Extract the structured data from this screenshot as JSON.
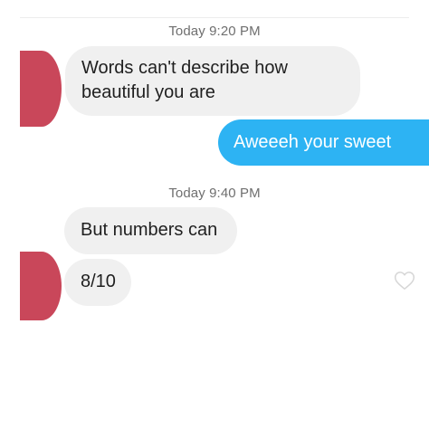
{
  "conversation": {
    "timestamps": [
      "Today 9:20 PM",
      "Today 9:40 PM"
    ],
    "messages": [
      {
        "text": "Words can't describe how beautiful you are"
      },
      {
        "text": "Aweeeh your sweet"
      },
      {
        "text": "But numbers can"
      },
      {
        "text": "8/10"
      }
    ]
  },
  "colors": {
    "sent_bubble": "#2db3f3",
    "received_bubble": "#f0f0f0",
    "avatar": "#c9475a"
  },
  "icons": {
    "like": "heart-outline-icon"
  }
}
